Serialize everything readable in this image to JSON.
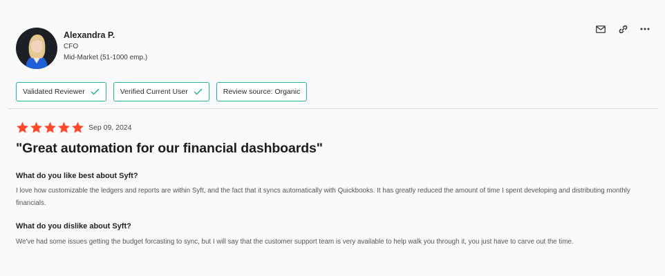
{
  "reviewer": {
    "name": "Alexandra P.",
    "title": "CFO",
    "segment": "Mid-Market (51-1000 emp.)"
  },
  "actions": {
    "icons": [
      "mail-icon",
      "link-icon",
      "more-icon"
    ]
  },
  "badges": [
    {
      "label": "Validated Reviewer",
      "check": true
    },
    {
      "label": "Verified Current User",
      "check": true
    },
    {
      "label": "Review source: Organic",
      "check": false
    }
  ],
  "review": {
    "rating": 5,
    "date": "Sep 09, 2024",
    "title": "\"Great automation for our financial dashboards\"",
    "sections": [
      {
        "question": "What do you like best about Syft?",
        "answer": "I love how customizable the ledgers and reports are within Syft, and the fact that it syncs automatically with Quickbooks. It has greatly reduced the amount of time I spent developing and distributing monthly financials."
      },
      {
        "question": "What do you dislike about Syft?",
        "answer": "We've had some issues getting the budget forcasting to sync, but I will say that the customer support team is very available to help walk you through it, you just have to carve out the time."
      }
    ]
  },
  "colors": {
    "star": "#ff492c",
    "badge_border": "#27b39a",
    "check": "#27b39a"
  }
}
